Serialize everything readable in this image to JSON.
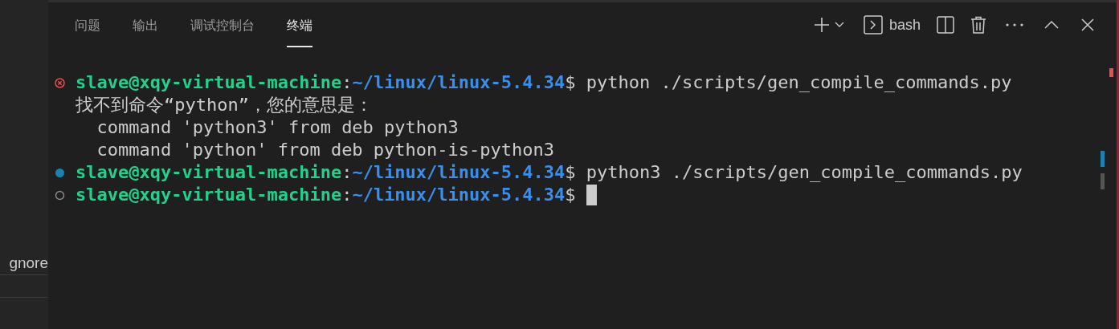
{
  "sidebar": {
    "items": [
      {
        "label": "gnore"
      }
    ]
  },
  "panel": {
    "tabs": [
      {
        "label": "问题",
        "selected": false
      },
      {
        "label": "输出",
        "selected": false
      },
      {
        "label": "调试控制台",
        "selected": false
      },
      {
        "label": "终端",
        "selected": true
      }
    ],
    "terminal_name": "bash"
  },
  "terminal": {
    "lines": [
      {
        "kind": "prompt",
        "decoration": {
          "kind": "error"
        },
        "user": "slave@xqy-virtual-machine",
        "separator": ":",
        "path": "~/linux/linux-5.4.34",
        "symbol": "$",
        "command": " python ./scripts/gen_compile_commands.py",
        "cursor": false
      },
      {
        "kind": "output",
        "text": "找不到命令“python”，您的意思是："
      },
      {
        "kind": "output",
        "text": "  command 'python3' from deb python3"
      },
      {
        "kind": "output",
        "text": "  command 'python' from deb python-is-python3"
      },
      {
        "kind": "prompt",
        "decoration": {
          "kind": "success"
        },
        "user": "slave@xqy-virtual-machine",
        "separator": ":",
        "path": "~/linux/linux-5.4.34",
        "symbol": "$",
        "command": " python3 ./scripts/gen_compile_commands.py",
        "cursor": false
      },
      {
        "kind": "prompt",
        "decoration": {
          "kind": "none"
        },
        "user": "slave@xqy-virtual-machine",
        "separator": ":",
        "path": "~/linux/linux-5.4.34",
        "symbol": "$",
        "cursor": true
      }
    ]
  }
}
